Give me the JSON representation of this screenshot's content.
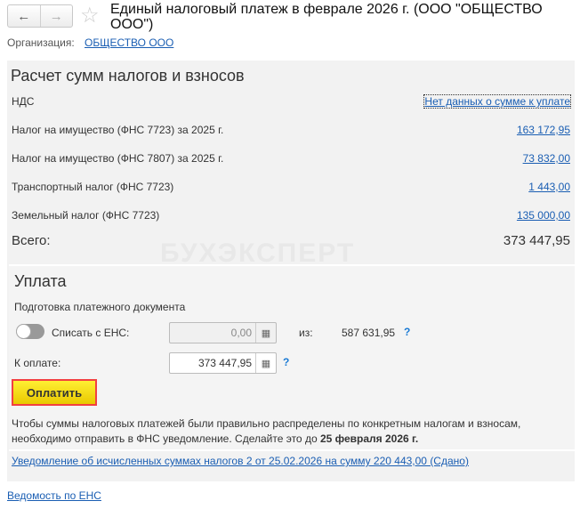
{
  "header": {
    "title": "Единый налоговый платеж в феврале 2026 г. (ООО \"ОБЩЕСТВО ООО\")",
    "back": "←",
    "forward": "→"
  },
  "organization": {
    "label": "Организация:",
    "value": "ОБЩЕСТВО ООО"
  },
  "calc": {
    "heading": "Расчет сумм налогов и взносов",
    "rows": [
      {
        "label": "НДС",
        "value": "Нет данных о сумме к уплате"
      },
      {
        "label": "Налог на имущество (ФНС 7723) за 2025 г.",
        "value": "163 172,95"
      },
      {
        "label": "Налог на имущество (ФНС 7807) за 2025 г.",
        "value": "73 832,00"
      },
      {
        "label": "Транспортный налог (ФНС 7723)",
        "value": "1 443,00"
      },
      {
        "label": "Земельный налог (ФНС 7723)",
        "value": "135 000,00"
      }
    ],
    "total_label": "Всего:",
    "total_value": "373 447,95"
  },
  "watermark": "БУХЭКСПЕРТ",
  "payment": {
    "heading": "Уплата",
    "subheading": "Подготовка платежного документа",
    "ens_label": "Списать с ЕНС:",
    "ens_value": "0,00",
    "of_label": "из:",
    "ens_balance": "587 631,95",
    "to_pay_label": "К оплате:",
    "to_pay_value": "373 447,95",
    "help": "?",
    "pay_button": "Оплатить"
  },
  "notice": {
    "text": "Чтобы суммы налоговых платежей были правильно распределены по конкретным налогам и взносам, необходимо отправить в ФНС уведомление. Сделайте это до ",
    "deadline": "25 февраля 2026 г.",
    "link": "Уведомление об исчисленных суммах налогов 2 от 25.02.2026 на сумму 220 443,00 (Сдано)"
  },
  "footer_link": "Ведомость по ЕНС"
}
